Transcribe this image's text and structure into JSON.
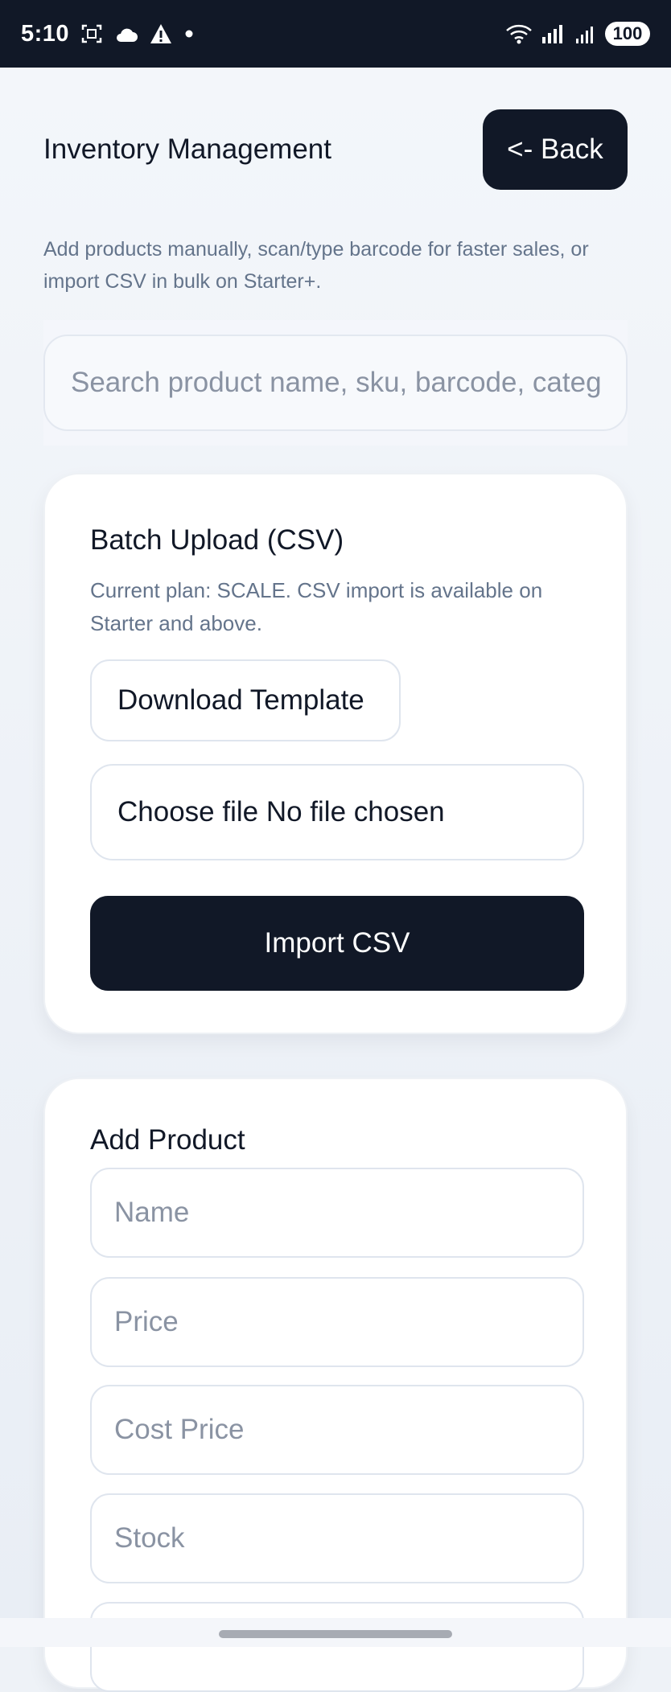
{
  "status_bar": {
    "time": "5:10",
    "battery": "100",
    "icons": [
      "screenshot-icon",
      "cloud-icon",
      "warning-icon",
      "dot-icon",
      "wifi-icon",
      "signal-icon"
    ]
  },
  "header": {
    "title": "Inventory Management",
    "back_label": "<- Back"
  },
  "subtitle": "Add products manually, scan/type barcode for faster sales, or import CSV in bulk on Starter+.",
  "search": {
    "placeholder": "Search product name, sku, barcode, categ"
  },
  "batch_upload": {
    "title": "Batch Upload (CSV)",
    "plan_note": "Current plan: SCALE. CSV import is available on Starter and above.",
    "download_label": "Download Template",
    "file_input_text": "Choose file No file chosen",
    "import_label": "Import CSV"
  },
  "add_product": {
    "title": "Add Product",
    "fields": [
      {
        "placeholder": "Name"
      },
      {
        "placeholder": "Price"
      },
      {
        "placeholder": "Cost Price"
      },
      {
        "placeholder": "Stock"
      }
    ]
  },
  "colors": {
    "dark": "#111827",
    "muted": "#64748b",
    "placeholder": "#8a93a3",
    "background": "#eef2f7"
  }
}
